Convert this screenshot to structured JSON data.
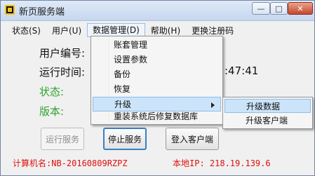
{
  "window": {
    "title": "新页服务端"
  },
  "controls": {
    "minimize": "—",
    "maximize": "□",
    "close": "✕"
  },
  "menubar": {
    "items": [
      "状态(S)",
      "用户(U)",
      "数据管理(D)",
      "帮助(H)",
      "更换注册码"
    ]
  },
  "fields": {
    "user_id_label": "用户编号:",
    "run_time_label": "运行时间:",
    "run_time_tail": ":47:41",
    "status_label": "状态:",
    "version_label": "版本:"
  },
  "colors": {
    "label_green": "#2ea32e",
    "footer_red": "#e01010"
  },
  "buttons": {
    "run": "运行服务",
    "stop": "停止服务",
    "login": "登入客户端"
  },
  "footer": {
    "computer_name": "计算机名:NB-20160809RZPZ",
    "local_ip": "本地IP: 218.19.139.6"
  },
  "dropdown": {
    "items": [
      "账套管理",
      "设置参数",
      "备份",
      "恢复",
      "升级",
      "重装系统后修复数据库"
    ]
  },
  "submenu": {
    "items": [
      "升级数据",
      "升级客户端"
    ]
  }
}
